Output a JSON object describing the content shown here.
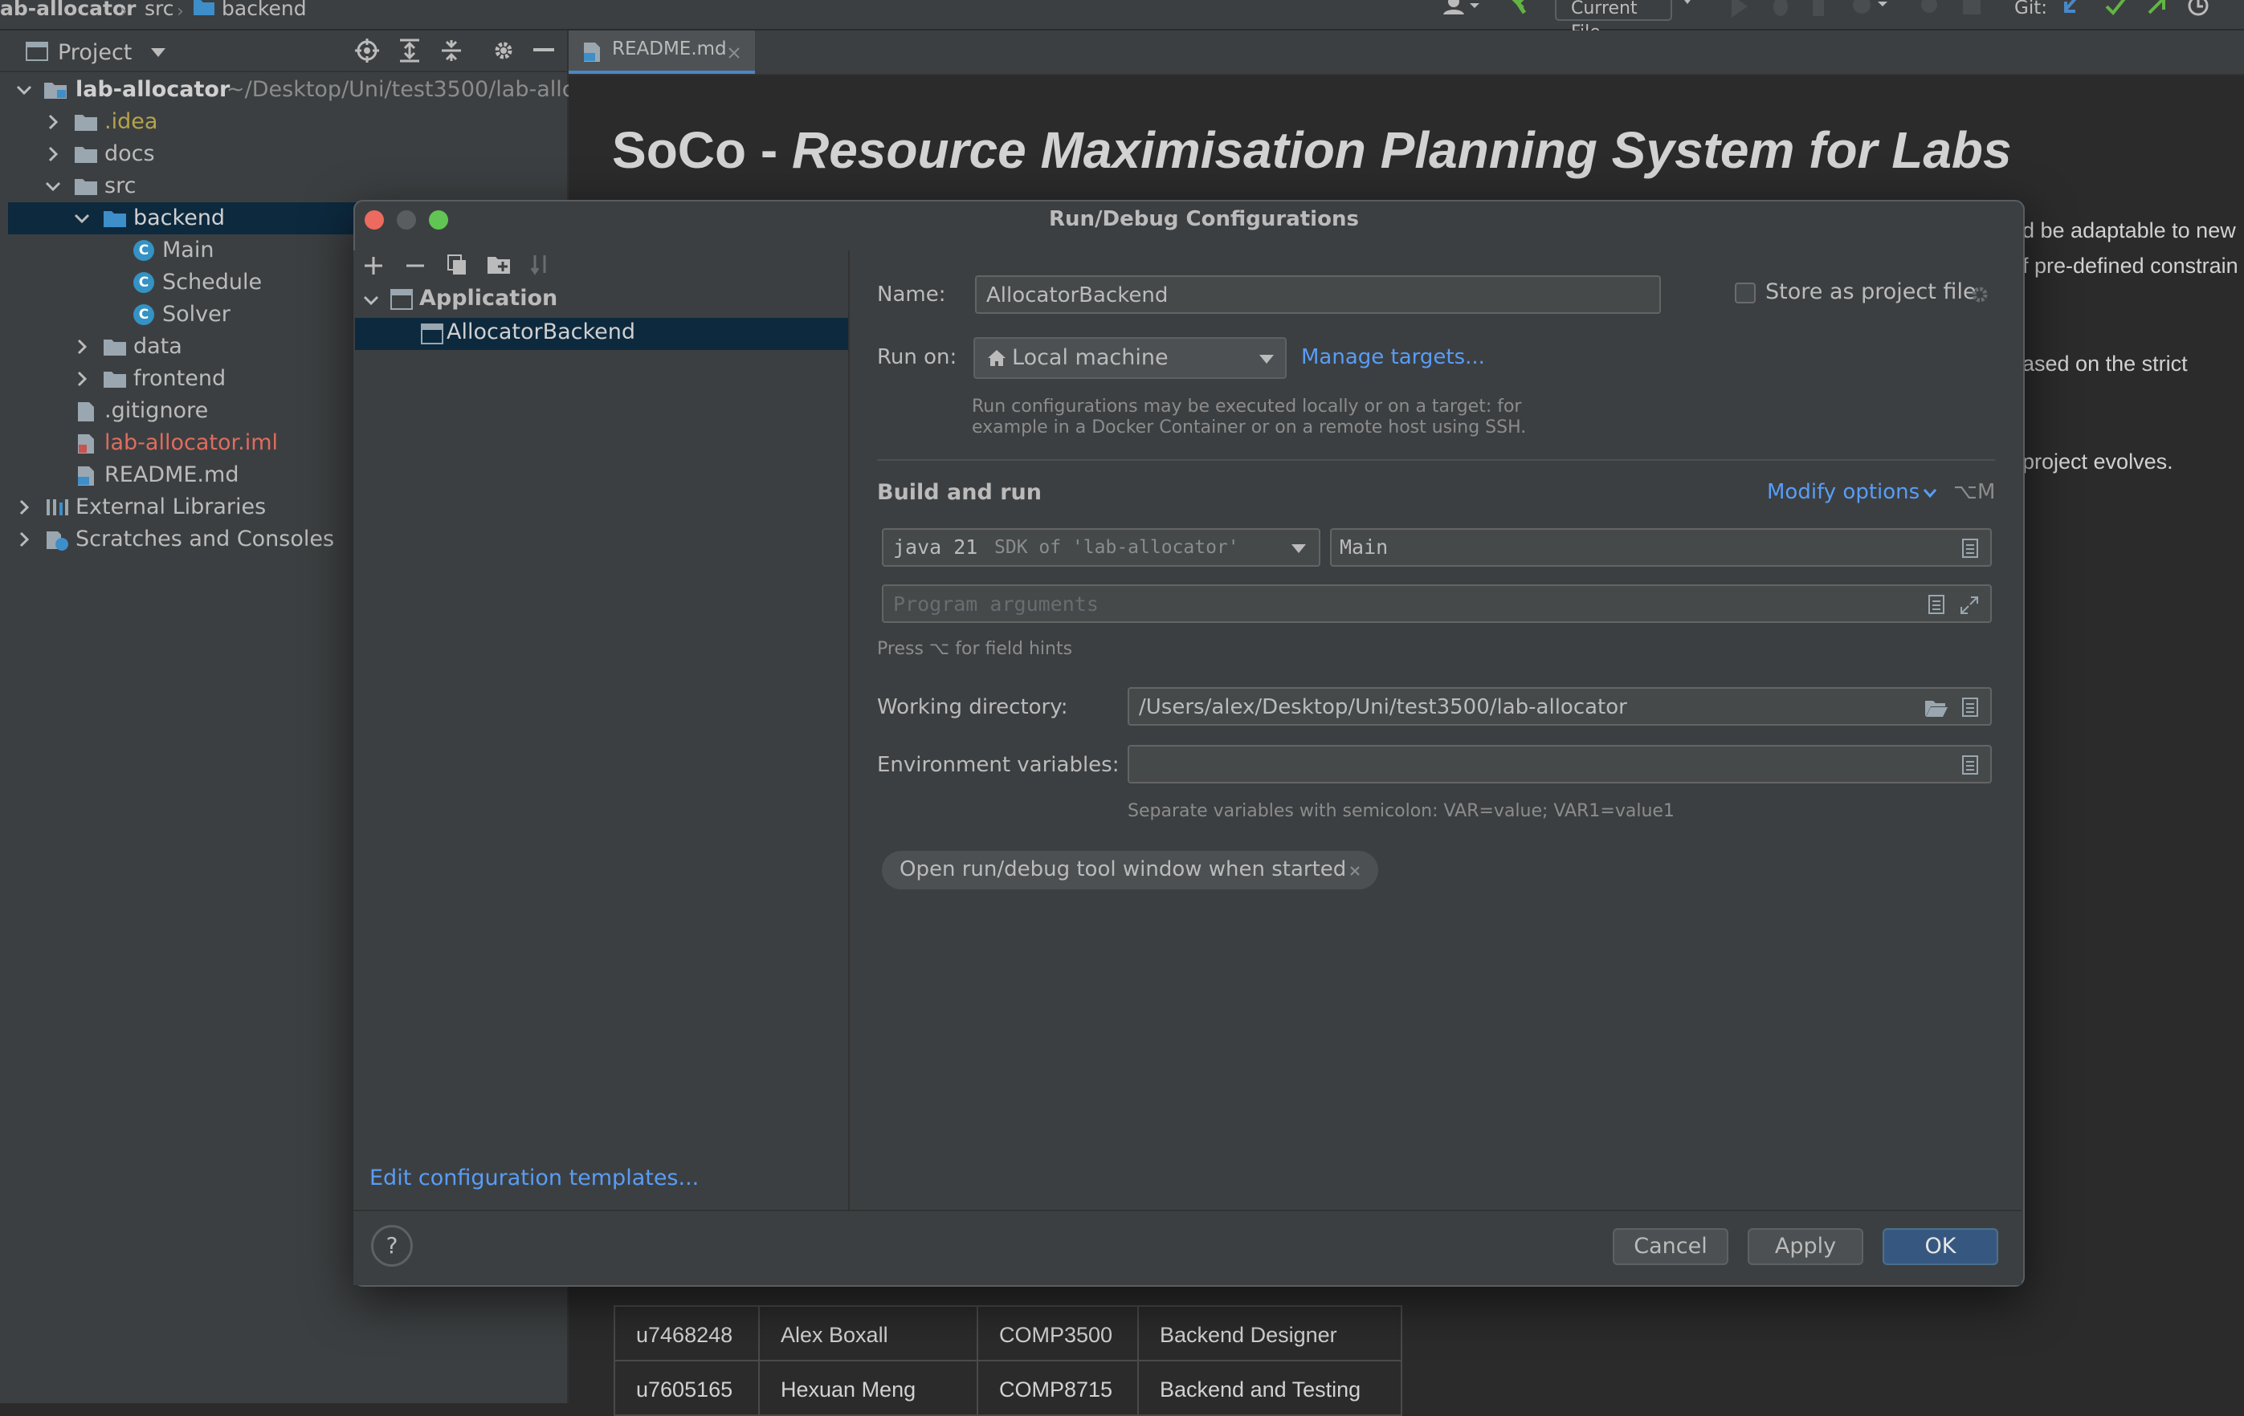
{
  "navbar": {
    "crumbs": [
      "ab-allocator",
      "src",
      "backend"
    ],
    "run_config": "Current File",
    "git_label": "Git:"
  },
  "project_panel": {
    "title": "Project",
    "tree": [
      {
        "label": "lab-allocator",
        "suffix": "~/Desktop/Uni/test3500/lab-allc",
        "depth": 0
      },
      {
        "label": ".idea",
        "depth": 1
      },
      {
        "label": "docs",
        "depth": 1
      },
      {
        "label": "src",
        "depth": 1
      },
      {
        "label": "backend",
        "depth": 2,
        "selected": true
      },
      {
        "label": "Main",
        "depth": 3
      },
      {
        "label": "Schedule",
        "depth": 3
      },
      {
        "label": "Solver",
        "depth": 3
      },
      {
        "label": "data",
        "depth": 2
      },
      {
        "label": "frontend",
        "depth": 2
      },
      {
        "label": ".gitignore",
        "depth": 1
      },
      {
        "label": "lab-allocator.iml",
        "depth": 1
      },
      {
        "label": "README.md",
        "depth": 1
      },
      {
        "label": "External Libraries",
        "depth": 0
      },
      {
        "label": "Scratches and Consoles",
        "depth": 0
      }
    ]
  },
  "editor": {
    "tab_label": "README.md",
    "heading_prefix": "SoCo - ",
    "heading_italic": "Resource Maximisation Planning System for Labs",
    "fragments": [
      "d be adaptable to new",
      "f pre-defined constrain",
      "ased on the strict",
      "project evolves."
    ],
    "table_rows": [
      [
        "u7468248",
        "Alex Boxall",
        "COMP3500",
        "Backend Designer"
      ],
      [
        "u7605165",
        "Hexuan Meng",
        "COMP8715",
        "Backend and Testing"
      ]
    ]
  },
  "dialog": {
    "title": "Run/Debug Configurations",
    "tree": {
      "group": "Application",
      "item": "AllocatorBackend"
    },
    "edit_templates": "Edit configuration templates...",
    "name_label": "Name:",
    "name_value": "AllocatorBackend",
    "store_as_project": "Store as project file",
    "run_on_label": "Run on:",
    "run_on_value": "Local machine",
    "manage_targets": "Manage targets...",
    "run_on_hint_1": "Run configurations may be executed locally or on a target: for",
    "run_on_hint_2": "example in a Docker Container or on a remote host using SSH.",
    "build_and_run": "Build and run",
    "modify_options": "Modify options",
    "modify_shortcut": "⌥M",
    "jdk_name": "java 21",
    "jdk_desc": "SDK of 'lab-allocator'",
    "main_class": "Main",
    "program_args_placeholder": "Program arguments",
    "field_hint": "Press ⌥ for field hints",
    "working_dir_label": "Working directory:",
    "working_dir_value": "/Users/alex/Desktop/Uni/test3500/lab-allocator",
    "env_label": "Environment variables:",
    "env_hint": "Separate variables with semicolon: VAR=value; VAR1=value1",
    "chip_label": "Open run/debug tool window when started",
    "cancel": "Cancel",
    "apply": "Apply",
    "ok": "OK"
  }
}
